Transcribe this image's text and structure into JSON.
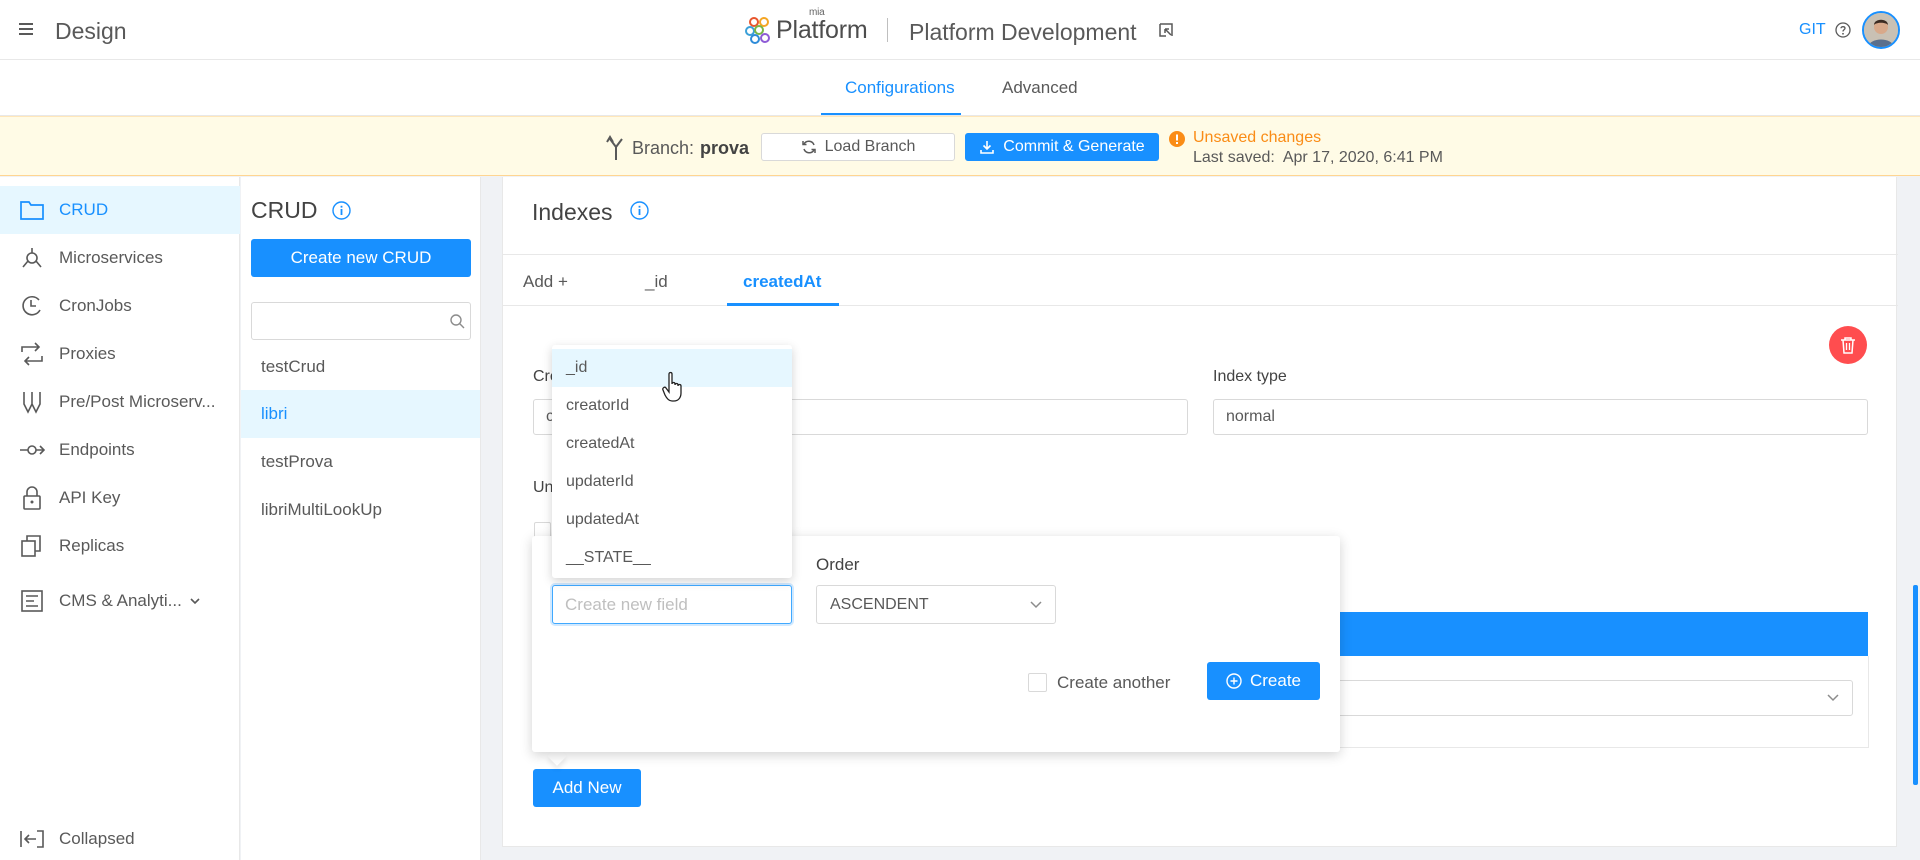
{
  "header": {
    "app_title": "Design",
    "brand_small": "mia",
    "brand_name": "Platform",
    "project_name": "Platform Development",
    "git_label": "GIT"
  },
  "main_tabs": [
    {
      "label": "Configurations",
      "active": true
    },
    {
      "label": "Advanced",
      "active": false
    }
  ],
  "branch_bar": {
    "branch_label": "Branch:",
    "branch_name": "prova",
    "load_button": "Load Branch",
    "commit_button": "Commit & Generate",
    "unsaved_text": "Unsaved changes",
    "last_saved_label": "Last saved:",
    "last_saved_value": "Apr 17, 2020, 6:41 PM"
  },
  "sidebar": {
    "items": [
      {
        "label": "CRUD",
        "icon": "folder-icon",
        "active": true
      },
      {
        "label": "Microservices",
        "icon": "microservices-icon",
        "active": false
      },
      {
        "label": "CronJobs",
        "icon": "cronjobs-icon",
        "active": false
      },
      {
        "label": "Proxies",
        "icon": "proxies-icon",
        "active": false
      },
      {
        "label": "Pre/Post Microserv...",
        "icon": "decorators-icon",
        "active": false
      },
      {
        "label": "Endpoints",
        "icon": "endpoints-icon",
        "active": false
      },
      {
        "label": "API Key",
        "icon": "lock-icon",
        "active": false
      },
      {
        "label": "Replicas",
        "icon": "replicas-icon",
        "active": false
      },
      {
        "label": "CMS & Analyti...",
        "icon": "cms-icon",
        "active": false
      }
    ],
    "collapse_label": "Collapsed"
  },
  "crud_panel": {
    "title": "CRUD",
    "create_button": "Create new CRUD",
    "search_value": "",
    "items": [
      {
        "label": "testCrud",
        "active": false
      },
      {
        "label": "libri",
        "active": true
      },
      {
        "label": "testProva",
        "active": false
      },
      {
        "label": "libriMultiLookUp",
        "active": false
      }
    ]
  },
  "indexes": {
    "title": "Indexes",
    "tabs": [
      {
        "label": "Add +",
        "active": false
      },
      {
        "label": "_id",
        "active": false
      },
      {
        "label": "createdAt",
        "active": true
      }
    ],
    "form": {
      "name_label_visible": "Cre",
      "name_input_partial": "c",
      "index_type_label": "Index type",
      "index_type_value": "normal",
      "unique_label_visible": "Un"
    },
    "add_new_button": "Add New"
  },
  "popover": {
    "field_placeholder": "Create new field",
    "order_label": "Order",
    "order_value": "ASCENDENT",
    "create_another_label": "Create another",
    "create_button": "Create"
  },
  "field_dropdown": {
    "options": [
      "_id",
      "creatorId",
      "createdAt",
      "updaterId",
      "updatedAt",
      "__STATE__"
    ],
    "hovered": "_id"
  },
  "colors": {
    "accent": "#1890ff",
    "warning": "#fa8c16",
    "danger": "#ff4d4f",
    "branch_bar_bg": "#fffbe6"
  }
}
